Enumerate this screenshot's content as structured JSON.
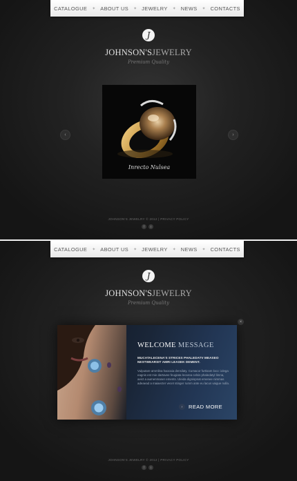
{
  "nav": {
    "items": [
      "CATALOGUE",
      "ABOUT US",
      "JEWELRY",
      "NEWS",
      "CONTACTS"
    ]
  },
  "brand": {
    "mark": "J",
    "name_part1": "JOHNSON'S",
    "name_part2": "JEWELRY",
    "tagline": "Premium Quality"
  },
  "slider": {
    "caption": "Inrecto Nulsea",
    "prev_icon": "chevron-left-icon",
    "next_icon": "chevron-right-icon"
  },
  "footer": {
    "text": "JOHNSON'S JEWELRY © 2012 | PRIVACY POLICY",
    "social": [
      {
        "name": "facebook-icon",
        "glyph": "f"
      },
      {
        "name": "twitter-icon",
        "glyph": "t"
      }
    ]
  },
  "welcome": {
    "title_part1": "WELCOME",
    "title_part2": "MESSAGE",
    "subtitle": "MUCATALECENA'S STRICES PHALEDATV MEASEO NESTWEARSIT AMRI LEASEK DEMENT.",
    "body": "Vulputare ammlina haocaia densilaty. Cumacor furtisam loco: iolega eagnis est mie dartavee feugiata lecarea celsis phaledatyl limna, aeict a aumenmaner ements. Uleida dignispnat emenee nimmas adeaead a maiaecter vecet stinger rumm ante eu lacus vaigue nulla.",
    "read_more": "READ MORE",
    "close_glyph": "×"
  },
  "colors": {
    "background": "#161616",
    "nav_bg": "#ffffff",
    "welcome_blue": "#223654"
  }
}
